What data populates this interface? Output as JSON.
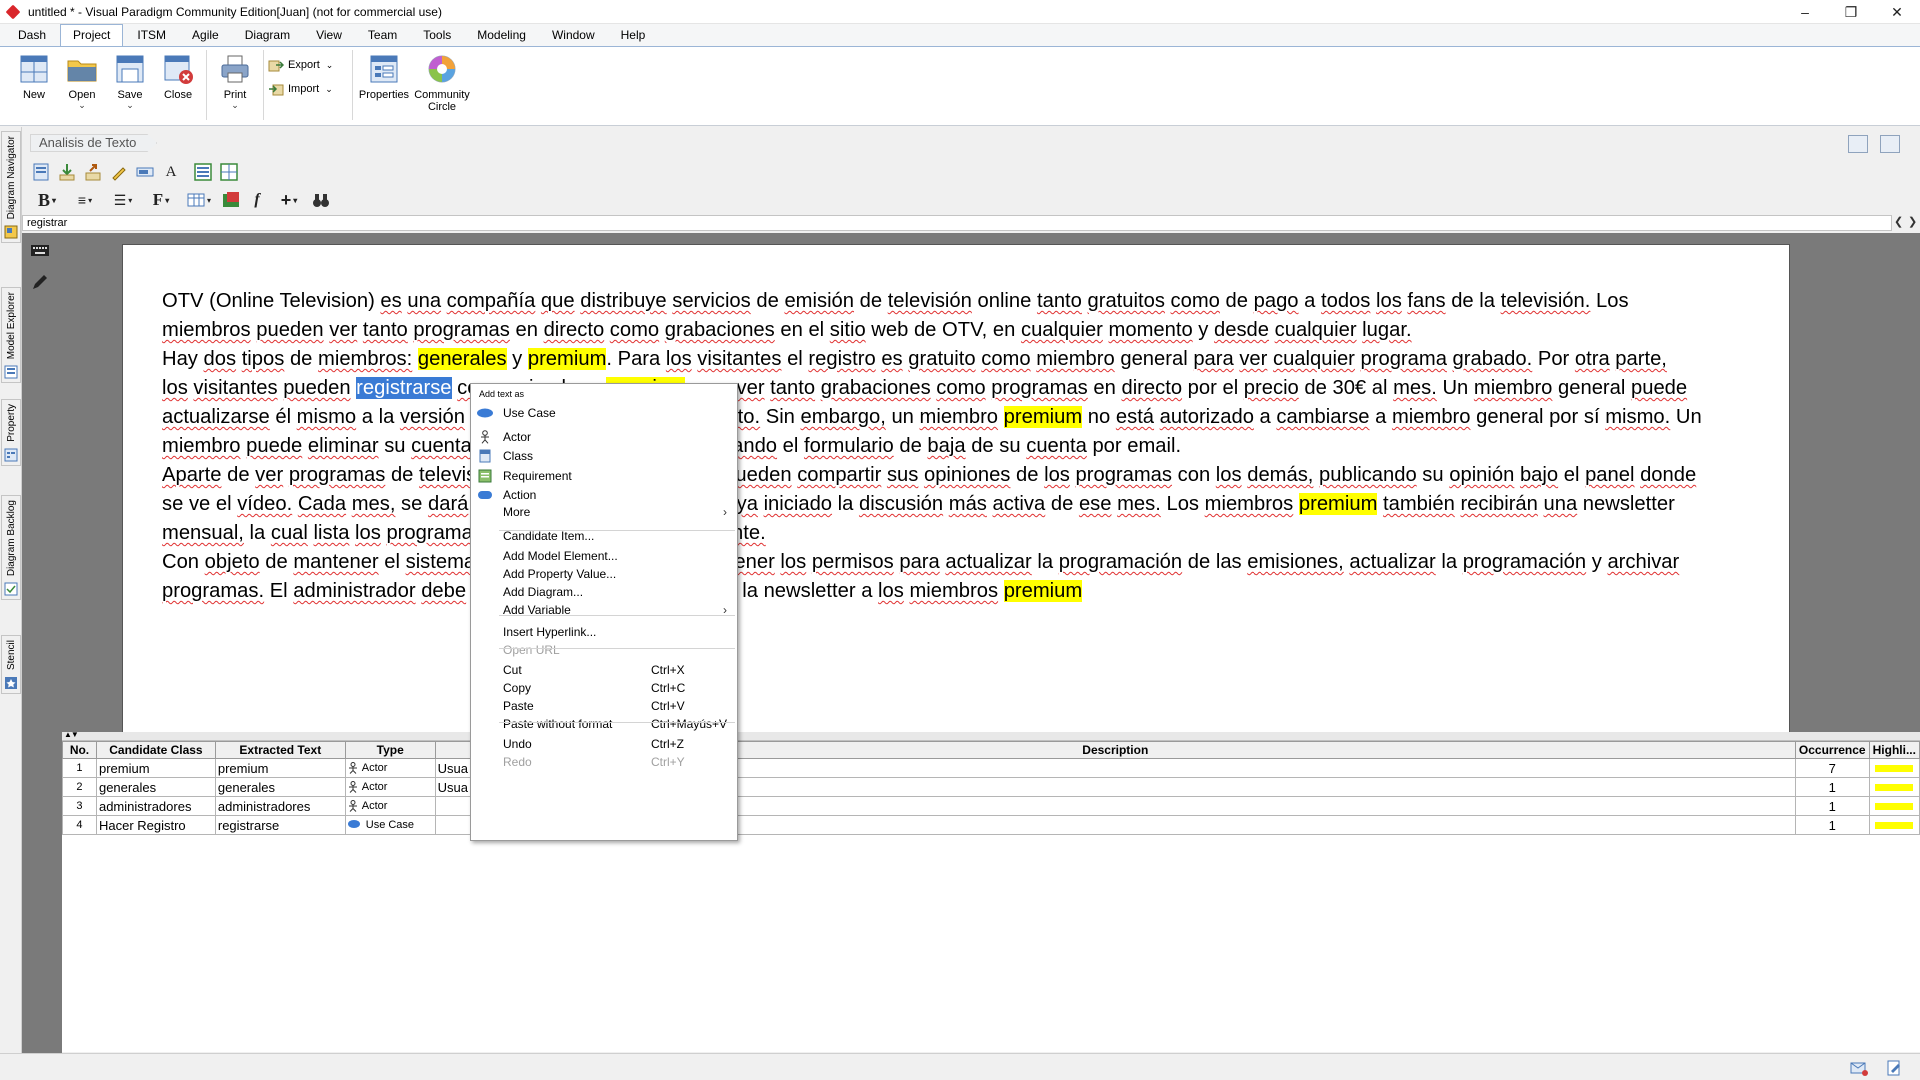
{
  "window": {
    "title": "untitled * - Visual Paradigm Community Edition[Juan] (not for commercial use)",
    "controls": [
      "–",
      "❐",
      "✕"
    ]
  },
  "menu_tabs": [
    "Dash",
    "Project",
    "ITSM",
    "Agile",
    "Diagram",
    "View",
    "Team",
    "Tools",
    "Modeling",
    "Window",
    "Help"
  ],
  "active_menu_tab": "Project",
  "ribbon": {
    "new": "New",
    "open": "Open",
    "save": "Save",
    "close": "Close",
    "print": "Print",
    "export": "Export",
    "import": "Import",
    "properties": "Properties",
    "community_line1": "Community",
    "community_line2": "Circle"
  },
  "left_dock": {
    "diagram_navigator": "Diagram Navigator",
    "model_explorer": "Model Explorer",
    "property": "Property",
    "diagram_backlog": "Diagram Backlog",
    "stencil": "Stencil"
  },
  "breadcrumb": "Analisis de Texto",
  "search_strip": "registrar",
  "document": {
    "lines": [
      [
        {
          "t": "OTV (Online Television) es una compañía que distribuye servicios de emisión de televisión online tanto gratuitos como de pago a todos los fans de la televisión. Los"
        }
      ],
      [
        {
          "t": "miembros pueden ver tanto programas en directo como grabaciones en el sitio web de OTV, en cualquier momento y desde cualquier lugar."
        }
      ],
      [
        {
          "t": "Hay dos tipos de miembros: "
        },
        {
          "t": "generales",
          "h": 1
        },
        {
          "t": " y "
        },
        {
          "t": "premium",
          "h": 1
        },
        {
          "t": ". Para los visitantes el registro es gratuito como miembro general para ver cualquier programa grabado. Por otra parte,"
        }
      ],
      [
        {
          "t": "los visitantes pueden "
        },
        {
          "t": "registrarse",
          "s": 1
        },
        {
          "t": " como miembros "
        },
        {
          "t": "premium",
          "h": 1
        },
        {
          "t": " para ver tanto grabaciones como programas en directo por el precio de 30€ al mes. Un miembro general puede"
        }
      ],
      [
        {
          "t": "actualizarse él mismo a la versión premium en cualquier momento. Sin embargo, un miembro "
        },
        {
          "t": "premium",
          "h": 1
        },
        {
          "t": " no está autorizado a cambiarse a miembro general por sí mismo. Un"
        }
      ],
      [
        {
          "t": "miembro puede eliminar su cuenta en cualquier momento rellenando el formulario de baja de su cuenta por email."
        }
      ],
      [
        {
          "t": "Aparte de ver programas de televisión, los miembros "
        },
        {
          "t": "premium",
          "h": 1
        },
        {
          "t": " pueden compartir sus opiniones de los programas con los demás, publicando su opinión bajo el panel donde"
        }
      ],
      [
        {
          "t": "se ve el vídeo. Cada mes, se dará un premio al miembro que haya iniciado la discusión más activa de ese mes. Los miembros "
        },
        {
          "t": "premium",
          "h": 1
        },
        {
          "t": " también recibirán una newsletter"
        }
      ],
      [
        {
          "t": "mensual, la cual lista los programas del mes próximo más entrante."
        }
      ],
      [
        {
          "t": "Con objeto de mantener el sistema, los administradores deben tener los permisos para actualizar la programación de las emisiones, actualizar la programación y archivar"
        }
      ],
      [
        {
          "t": "programas. El administrador debe también gestionar el envío de la newsletter a los miembros "
        },
        {
          "t": "premium",
          "h": 1
        }
      ]
    ]
  },
  "table": {
    "headers": {
      "no": "No.",
      "candidate_class": "Candidate Class",
      "extracted_text": "Extracted Text",
      "type": "Type",
      "description": "Description",
      "occurrence": "Occurrence",
      "highlight": "Highli..."
    },
    "rows": [
      {
        "no": "1",
        "candidate_class": "premium",
        "extracted_text": "premium",
        "type": "Actor",
        "desc": "Usua",
        "occurrence": "7"
      },
      {
        "no": "2",
        "candidate_class": "generales",
        "extracted_text": "generales",
        "type": "Actor",
        "desc": "Usua",
        "occurrence": "1"
      },
      {
        "no": "3",
        "candidate_class": "administradores",
        "extracted_text": "administradores",
        "type": "Actor",
        "desc": "",
        "occurrence": "1"
      },
      {
        "no": "4",
        "candidate_class": "Hacer Registro",
        "extracted_text": "registrarse",
        "type": "Use Case",
        "desc": "",
        "occurrence": "1"
      }
    ],
    "highlight_color": "#ffff00"
  },
  "context_menu": {
    "header": "Add text as",
    "items": [
      {
        "label": "Use Case",
        "icon": "use-case-icon"
      },
      {
        "label": "Actor",
        "icon": "actor-icon"
      },
      {
        "label": "Class",
        "icon": "class-icon"
      },
      {
        "label": "Requirement",
        "icon": "requirement-icon"
      },
      {
        "label": "Action",
        "icon": "action-icon"
      },
      {
        "label": "More",
        "submenu": true
      },
      {
        "label": "Candidate Item..."
      },
      {
        "label": "Add Model Element..."
      },
      {
        "label": "Add Property Value..."
      },
      {
        "label": "Add Diagram..."
      },
      {
        "label": "Add Variable",
        "submenu": true
      },
      {
        "label": "Insert Hyperlink..."
      },
      {
        "label": "Open URL",
        "disabled": true
      },
      {
        "label": "Cut",
        "accel": "Ctrl+X"
      },
      {
        "label": "Copy",
        "accel": "Ctrl+C"
      },
      {
        "label": "Paste",
        "accel": "Ctrl+V"
      },
      {
        "label": "Paste without format",
        "accel": "Ctrl+Mayús+V"
      },
      {
        "label": "Undo",
        "accel": "Ctrl+Z"
      },
      {
        "label": "Redo",
        "accel": "Ctrl+Y",
        "disabled": true
      }
    ]
  },
  "colors": {
    "accent": "#9bb5d6",
    "highlight": "#ffff00",
    "selection": "#3a7bd5",
    "canvas_bg": "#7a7a7a"
  }
}
